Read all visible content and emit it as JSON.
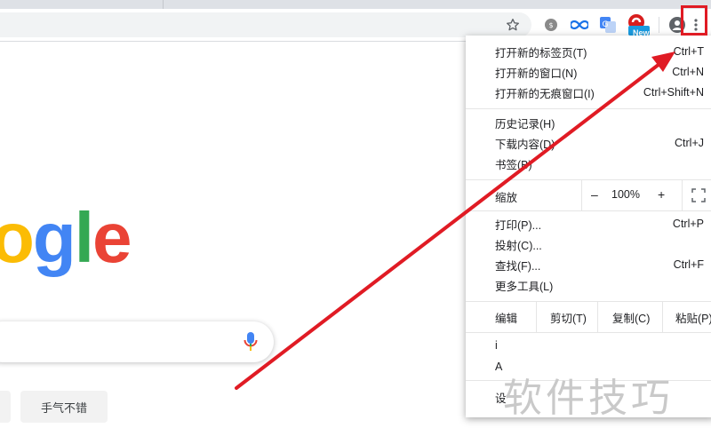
{
  "menu": {
    "new_tab": {
      "label": "打开新的标签页(T)",
      "shortcut": "Ctrl+T"
    },
    "new_window": {
      "label": "打开新的窗口(N)",
      "shortcut": "Ctrl+N"
    },
    "new_incognito": {
      "label": "打开新的无痕窗口(I)",
      "shortcut": "Ctrl+Shift+N"
    },
    "history": {
      "label": "历史记录(H)"
    },
    "downloads": {
      "label": "下载内容(D)",
      "shortcut": "Ctrl+J"
    },
    "bookmarks": {
      "label": "书签(B)"
    },
    "zoom": {
      "label": "缩放",
      "minus": "–",
      "value": "100%",
      "plus": "+"
    },
    "print": {
      "label": "打印(P)...",
      "shortcut": "Ctrl+P"
    },
    "cast": {
      "label": "投射(C)..."
    },
    "find": {
      "label": "查找(F)...",
      "shortcut": "Ctrl+F"
    },
    "more_tools": {
      "label": "更多工具(L)"
    },
    "edit": {
      "label": "编辑",
      "cut": "剪切(T)",
      "copy": "复制(C)",
      "paste": "粘贴(P)"
    },
    "partial_items": [
      "i",
      "A",
      "设"
    ]
  },
  "toolbar": {
    "extension_badge": "New"
  },
  "google": {
    "logo_letters": [
      {
        "char": "o",
        "color": "#fbbc05"
      },
      {
        "char": "g",
        "color": "#4285f4"
      },
      {
        "char": "l",
        "color": "#34a853"
      },
      {
        "char": "e",
        "color": "#ea4335"
      }
    ],
    "lucky_button": "手气不错"
  },
  "watermark": "软件技巧",
  "colors": {
    "annotation_red": "#e01b24"
  }
}
